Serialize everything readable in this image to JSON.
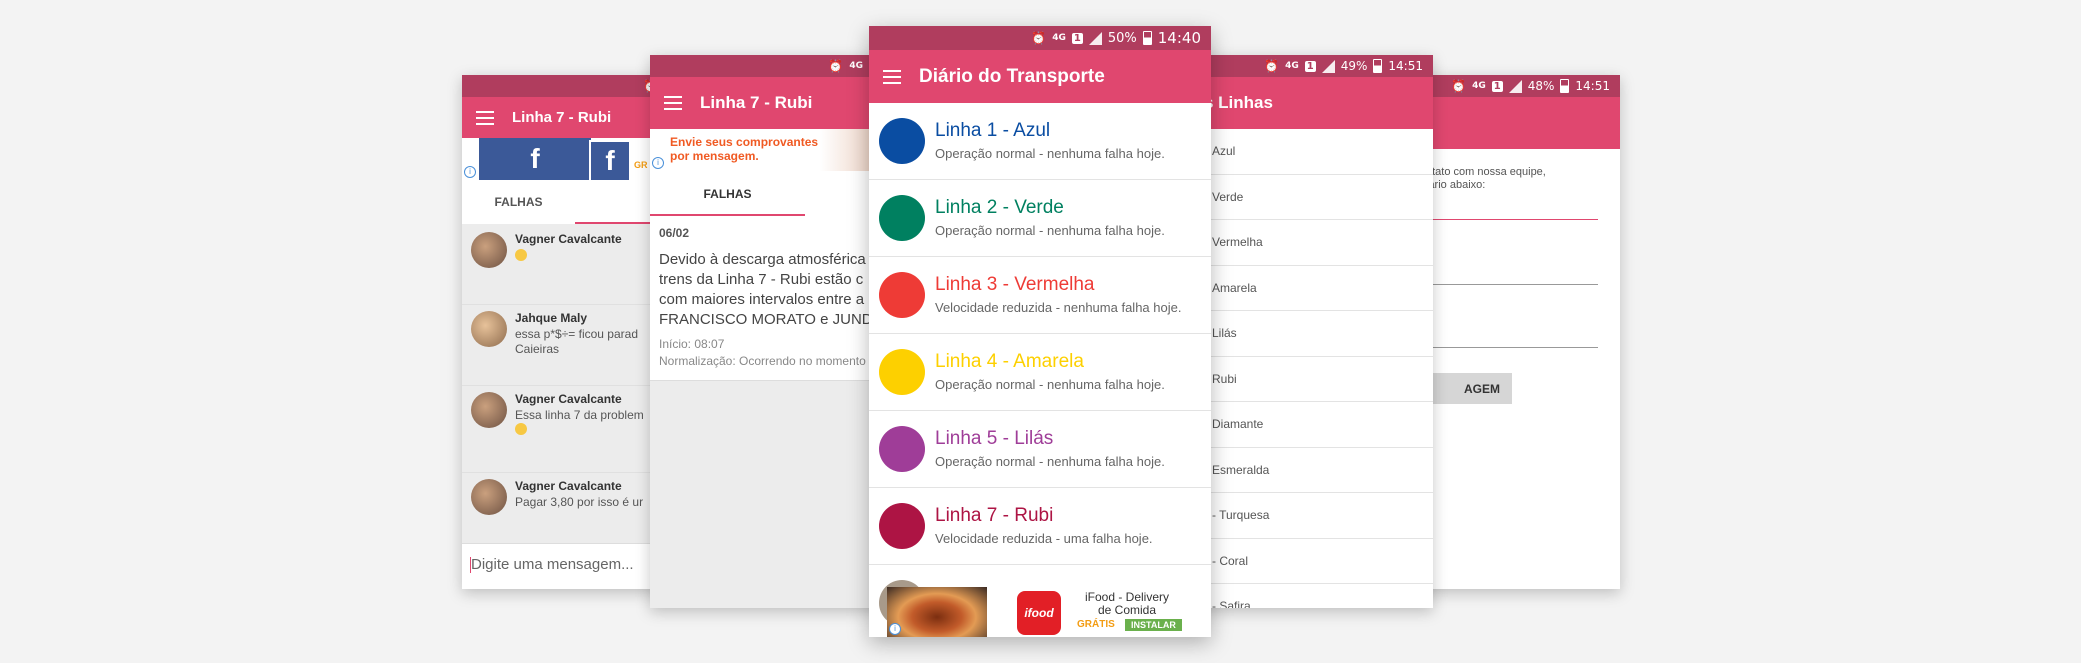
{
  "status": {
    "p1_time": "",
    "p3_battery": "50%",
    "p3_time": "14:40",
    "p4_battery": "49%",
    "p4_time": "14:51",
    "p5_battery": "48%",
    "p5_time": "14:51",
    "net": "4G"
  },
  "phone1": {
    "title": "Linha 7 - Rubi",
    "ad_badge": "GR",
    "tabs": [
      "FALHAS"
    ],
    "messages": [
      {
        "name": "Vagner Cavalcante",
        "text": ""
      },
      {
        "name": "Jahque Maly",
        "text": "essa p*$÷= ficou parad Caieiras"
      },
      {
        "name": "Vagner Cavalcante",
        "text": "Essa linha 7 da problem"
      },
      {
        "name": "Vagner Cavalcante",
        "text": "Pagar 3,80 por isso é ur"
      }
    ],
    "input_placeholder": "Digite uma mensagem..."
  },
  "phone2": {
    "title": "Linha 7 - Rubi",
    "ad_text": "Envie seus comprovantes por mensagem.",
    "tabs": [
      "FALHAS"
    ],
    "date": "06/02",
    "message_lines": [
      "Devido à descarga atmosférica",
      "trens da Linha 7 - Rubi estão c",
      "com maiores intervalos entre a",
      "FRANCISCO MORATO e JUND"
    ],
    "start": "Início: 08:07",
    "normalization": "Normalização: Ocorrendo no momento"
  },
  "phone3": {
    "title": "Diário do Transporte",
    "lines": [
      {
        "name": "Linha 1 - Azul",
        "status": "Operação normal - nenhuma falha hoje.",
        "color": "#0a4da2"
      },
      {
        "name": "Linha 2 - Verde",
        "status": "Operação normal - nenhuma falha hoje.",
        "color": "#008060"
      },
      {
        "name": "Linha 3 - Vermelha",
        "status": "Velocidade reduzida - nenhuma falha hoje.",
        "color": "#ee3b36"
      },
      {
        "name": "Linha 4 - Amarela",
        "status": "Operação normal - nenhuma falha hoje.",
        "color": "#fdd000"
      },
      {
        "name": "Linha 5 - Lilás",
        "status": "Operação normal - nenhuma falha hoje.",
        "color": "#9f3d98"
      },
      {
        "name": "Linha 7 - Rubi",
        "status": "Velocidade reduzida - uma falha hoje.",
        "color": "#ad1444"
      }
    ],
    "ad": {
      "title": "iFood - Delivery de Comida",
      "free": "GRÁTIS",
      "install": "INSTALAR",
      "logo": "ifood"
    }
  },
  "phone4": {
    "title": "s Linhas",
    "items": [
      "Azul",
      "Verde",
      "Vermelha",
      "Amarela",
      "Lilás",
      "Rubi",
      "Diamante",
      "Esmeralda",
      "- Turquesa",
      "- Coral",
      "- Safira"
    ]
  },
  "phone5": {
    "text_line1": "ntato com nossa equipe,",
    "text_line2": "lário abaixo:",
    "button": "AGEM"
  }
}
